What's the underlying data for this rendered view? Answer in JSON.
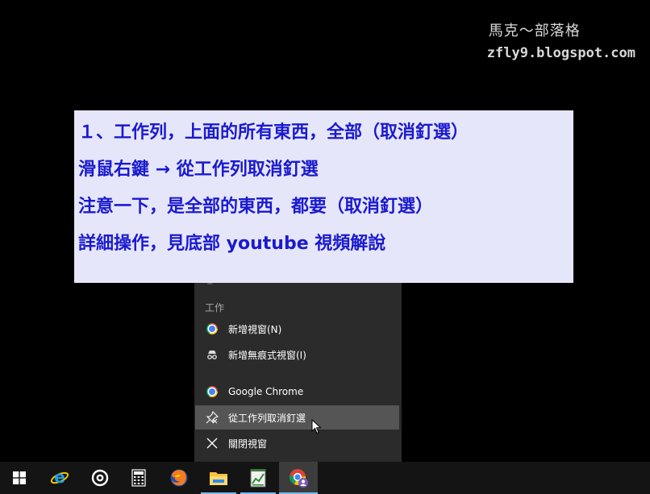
{
  "watermark": {
    "title": "馬克～部落格",
    "url": "zfly9.blogspot.com"
  },
  "note": {
    "lines": [
      "１、工作列，上面的所有東西，全部（取消釘選）",
      "滑鼠右鍵 → 從工作列取消釘選",
      "注意一下，是全部的東西，都要（取消釘選）",
      "詳細操作，見底部 youtube 視頻解說"
    ]
  },
  "jumplist": {
    "section_title": "工作",
    "items": [
      {
        "label": "新增視窗(N)",
        "icon": "chrome-icon"
      },
      {
        "label": "新增無痕式視窗(I)",
        "icon": "incognito-icon"
      },
      {
        "label": "Google Chrome",
        "icon": "chrome-icon"
      },
      {
        "label": "從工作列取消釘選",
        "icon": "unpin-icon"
      },
      {
        "label": "關閉視窗",
        "icon": "close-icon"
      }
    ]
  },
  "taskbar": {
    "items": [
      {
        "name": "start-button",
        "icon": "windows-icon"
      },
      {
        "name": "edge",
        "icon": "internet-explorer-icon"
      },
      {
        "name": "groove",
        "icon": "groove-music-icon"
      },
      {
        "name": "calculator",
        "icon": "calculator-icon"
      },
      {
        "name": "firefox",
        "icon": "firefox-icon"
      },
      {
        "name": "file-explorer",
        "icon": "folder-icon"
      },
      {
        "name": "notepad",
        "icon": "notepad-chart-icon"
      },
      {
        "name": "chrome",
        "icon": "chrome-icon"
      }
    ]
  },
  "colors": {
    "note_bg": "#e6e6fa",
    "note_text": "#1a1ad0",
    "menu_bg": "#2b2b2b",
    "taskbar_bg": "#141414",
    "accent": "#76b9ed"
  }
}
